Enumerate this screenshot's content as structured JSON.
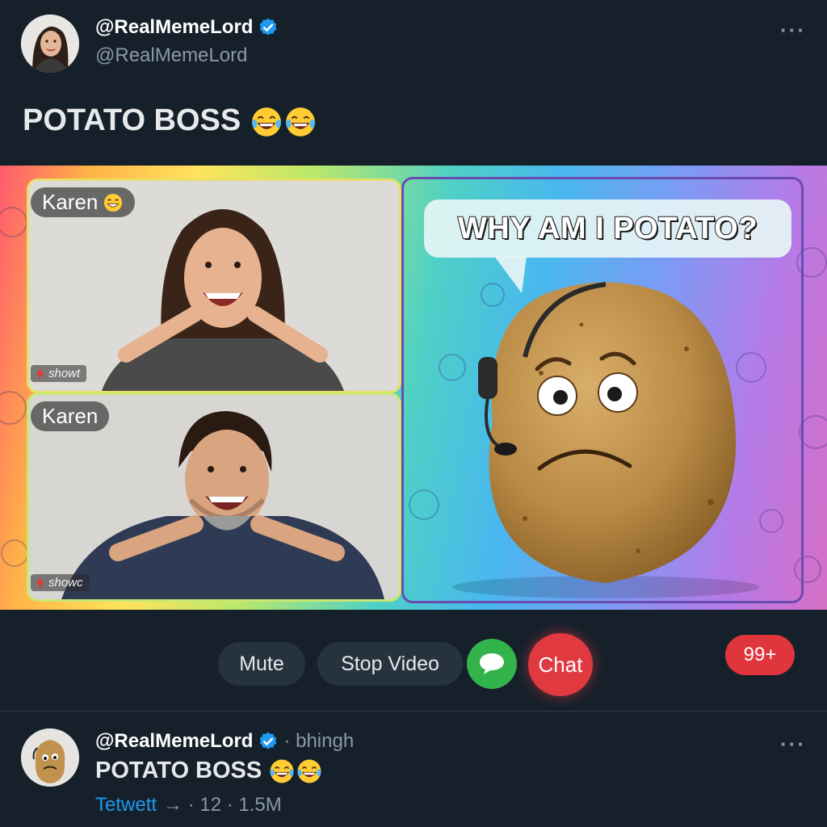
{
  "tweet": {
    "display_name": "@RealMemeLord",
    "handle": "@RealMemeLord",
    "text": "POTATO BOSS"
  },
  "call": {
    "participants": [
      {
        "name": "Karen",
        "brand": "showt"
      },
      {
        "name": "Karen",
        "brand": "showc"
      }
    ],
    "speech_bubble": "WHY AM I POTATO?"
  },
  "controls": {
    "mute_label": "Mute",
    "stop_video_label": "Stop Video",
    "chat_label": "Chat",
    "badge": "99+"
  },
  "reply_tweet": {
    "display_name": "@RealMemeLord",
    "meta": "· bhingh",
    "text": "POTATO BOSS",
    "footer_link": "Tetwett",
    "footer_stats": "→ · 12 · 1.5M"
  },
  "icons": [
    "verified-badge-icon",
    "more-options-icon",
    "laughing-emoji-icon",
    "grin-emoji-icon",
    "chat-bubble-icon",
    "lightning-icon"
  ],
  "colors": {
    "background": "#15202b",
    "verified": "#1d9bf0",
    "chat_button": "#e03a40",
    "message_button": "#33b44a",
    "badge": "#e0353c",
    "link": "#1d9bf0"
  }
}
